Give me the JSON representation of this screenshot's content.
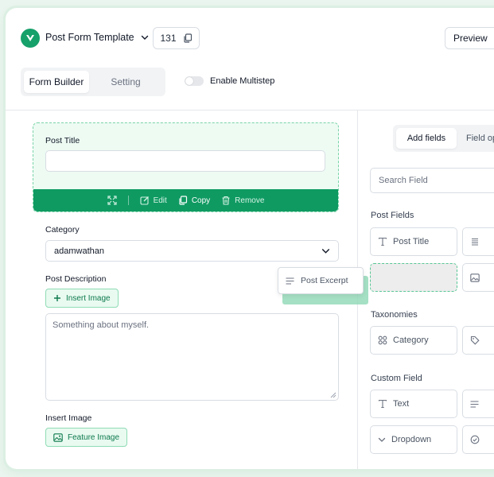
{
  "header": {
    "title": "Post Form Template",
    "count": "131",
    "preview_label": "Preview"
  },
  "tabs": {
    "form_builder": "Form Builder",
    "setting": "Setting"
  },
  "multistep": {
    "label": "Enable Multistep",
    "enabled": false
  },
  "form": {
    "post_title_label": "Post Title",
    "post_title_value": "",
    "actions": {
      "edit": "Edit",
      "copy": "Copy",
      "remove": "Remove"
    },
    "category_label": "Category",
    "category_value": "adamwathan",
    "post_description_label": "Post Description",
    "insert_image_button": "Insert Image",
    "description_value": "Something about myself.",
    "insert_image_label": "Insert Image",
    "feature_image_button": "Feature Image"
  },
  "drag_ghost": {
    "label": "Post Excerpt"
  },
  "fields_panel": {
    "tabs": {
      "add_fields": "Add fields",
      "field_options": "Field op"
    },
    "search_placeholder": "Search Field",
    "sections": {
      "post_fields": "Post Fields",
      "taxonomies": "Taxonomies",
      "custom_field": "Custom Field"
    },
    "post_fields": [
      "Post Title"
    ],
    "taxonomies": [
      "Category"
    ],
    "custom_fields": [
      "Text",
      "Dropdown"
    ]
  },
  "colors": {
    "brand": "#16a06a",
    "action_bar": "#0f9a62",
    "selected_bg": "#edfbf3"
  }
}
